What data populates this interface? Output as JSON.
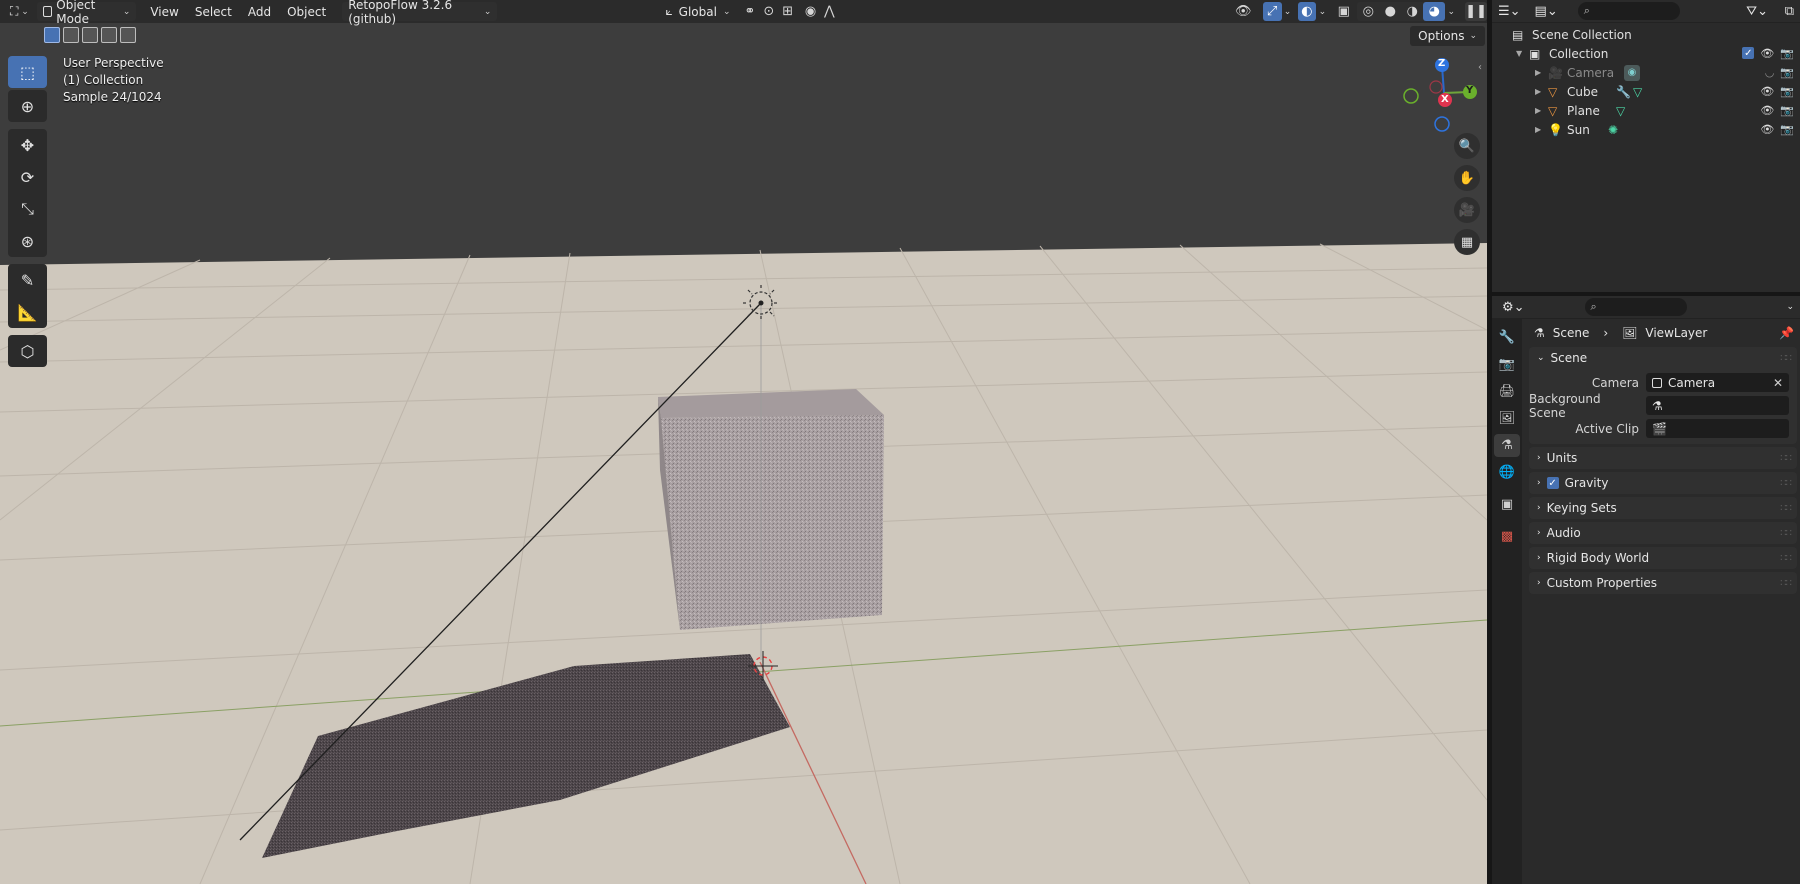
{
  "viewport_header": {
    "mode": "Object Mode",
    "menus": [
      "View",
      "Select",
      "Add",
      "Object"
    ],
    "addon": "RetopoFlow 3.2.6 (github)",
    "orientation": "Global",
    "options": "Options"
  },
  "overlay": {
    "line1": "User Perspective",
    "line2": "(1) Collection",
    "line3": "Sample 24/1024"
  },
  "gizmo": {
    "z": "Z",
    "y": "Y",
    "x": "X"
  },
  "outliner": {
    "scene_collection": "Scene Collection",
    "collection": "Collection",
    "items": [
      {
        "name": "Camera",
        "icon": "camera-object-icon"
      },
      {
        "name": "Cube",
        "icon": "mesh-object-icon"
      },
      {
        "name": "Plane",
        "icon": "mesh-object-icon"
      },
      {
        "name": "Sun",
        "icon": "light-object-icon"
      }
    ]
  },
  "properties": {
    "breadcrumb_scene": "Scene",
    "breadcrumb_layer": "ViewLayer",
    "scene_panel": "Scene",
    "camera_label": "Camera",
    "camera_value": "Camera",
    "background_label": "Background Scene",
    "clip_label": "Active Clip",
    "panels": {
      "units": "Units",
      "gravity": "Gravity",
      "keying": "Keying Sets",
      "audio": "Audio",
      "rigid": "Rigid Body World",
      "custom": "Custom Properties"
    }
  },
  "colors": {
    "accent": "#4772b3",
    "floor": "#cdc6bb",
    "world": "#3d3d3d"
  }
}
